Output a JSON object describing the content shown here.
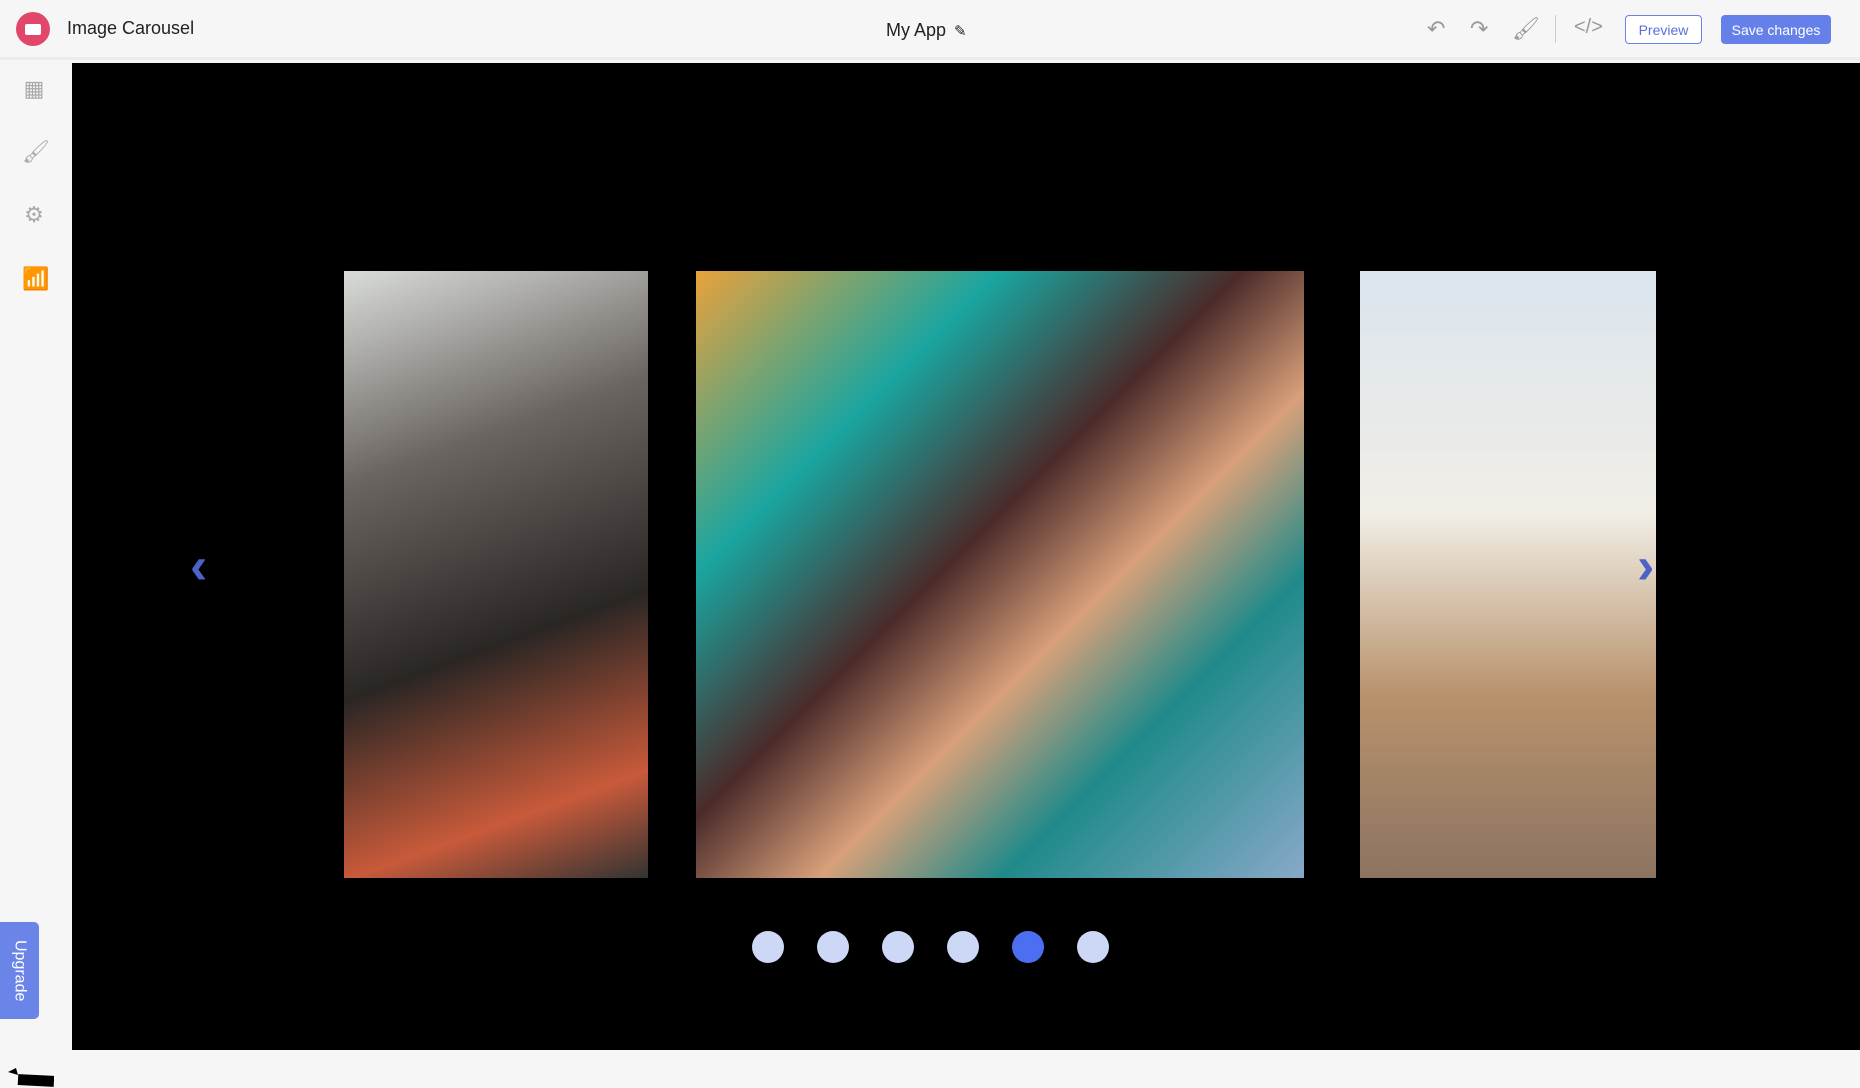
{
  "header": {
    "app_title": "Image Carousel",
    "center_title": "My App",
    "preview_label": "Preview",
    "save_label": "Save changes"
  },
  "sidebar": {
    "items": [
      "layout",
      "style",
      "settings",
      "analytics"
    ],
    "upgrade_label": "Upgrade"
  },
  "carousel": {
    "slide_count": 6,
    "active_index": 4,
    "accent": "#4c6ef0",
    "dot_color": "#ccd8f6"
  }
}
